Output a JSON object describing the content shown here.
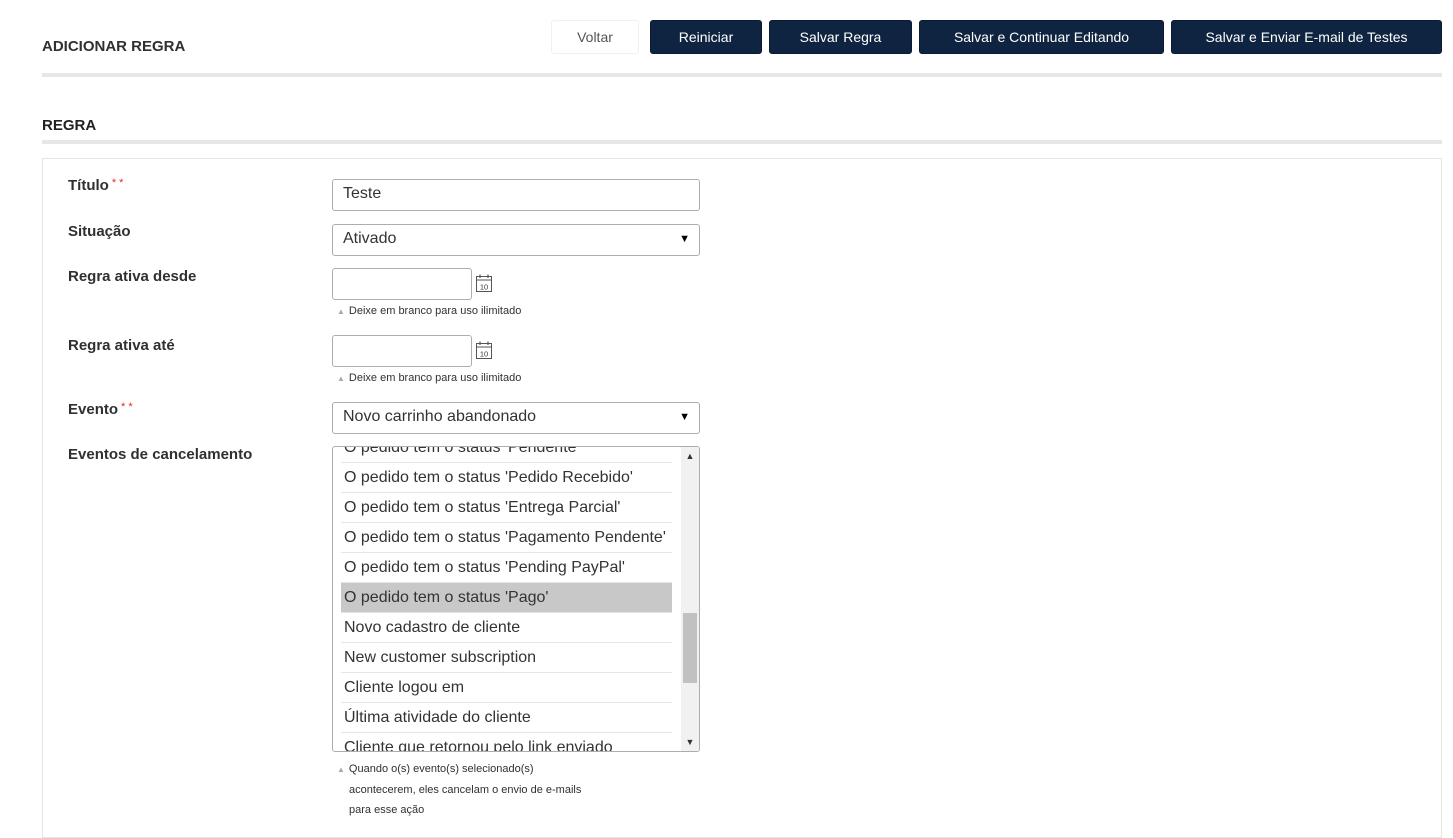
{
  "header": {
    "title": "ADICIONAR REGRA",
    "buttons": {
      "back": "Voltar",
      "reset": "Reiniciar",
      "save": "Salvar Regra",
      "save_continue": "Salvar e Continuar Editando",
      "save_email": "Salvar e Enviar E-mail de Testes"
    }
  },
  "section": {
    "title": "REGRA"
  },
  "form": {
    "title": {
      "label": "Título",
      "required_mark": "* *",
      "value": "Teste"
    },
    "status": {
      "label": "Situação",
      "value": "Ativado",
      "arrow": "▼"
    },
    "active_from": {
      "label": "Regra ativa desde",
      "value": "",
      "icon": "calendar-icon",
      "hint": "Deixe em branco para uso ilimitado",
      "calendar_day": "10"
    },
    "active_to": {
      "label": "Regra ativa até",
      "value": "",
      "icon": "calendar-icon",
      "hint": "Deixe em branco para uso ilimitado",
      "calendar_day": "10"
    },
    "event": {
      "label": "Evento",
      "required_mark": "* *",
      "value": "Novo carrinho abandonado",
      "arrow": "▼"
    },
    "cancel_events": {
      "label": "Eventos de cancelamento",
      "options": [
        "O pedido tem o status 'Pendente'",
        "O pedido tem o status 'Pedido Recebido'",
        "O pedido tem o status 'Entrega Parcial'",
        "O pedido tem o status 'Pagamento Pendente'",
        "O pedido tem o status 'Pending PayPal'",
        "O pedido tem o status 'Pago'",
        "Novo cadastro de cliente",
        "New customer subscription",
        "Cliente logou em",
        "Última atividade do cliente",
        "Cliente que retornou pelo link enviado"
      ],
      "selected_index": 5,
      "scroll_up": "▲",
      "scroll_down": "▼",
      "hint_lines": [
        "Quando o(s) evento(s) selecionado(s)",
        "acontecerem, eles cancelam o envio de e-mails",
        "para esse ação"
      ]
    }
  },
  "colors": {
    "button_dark": "#0f2440",
    "required": "#e02b27",
    "selected_option": "#c8c8c8"
  }
}
